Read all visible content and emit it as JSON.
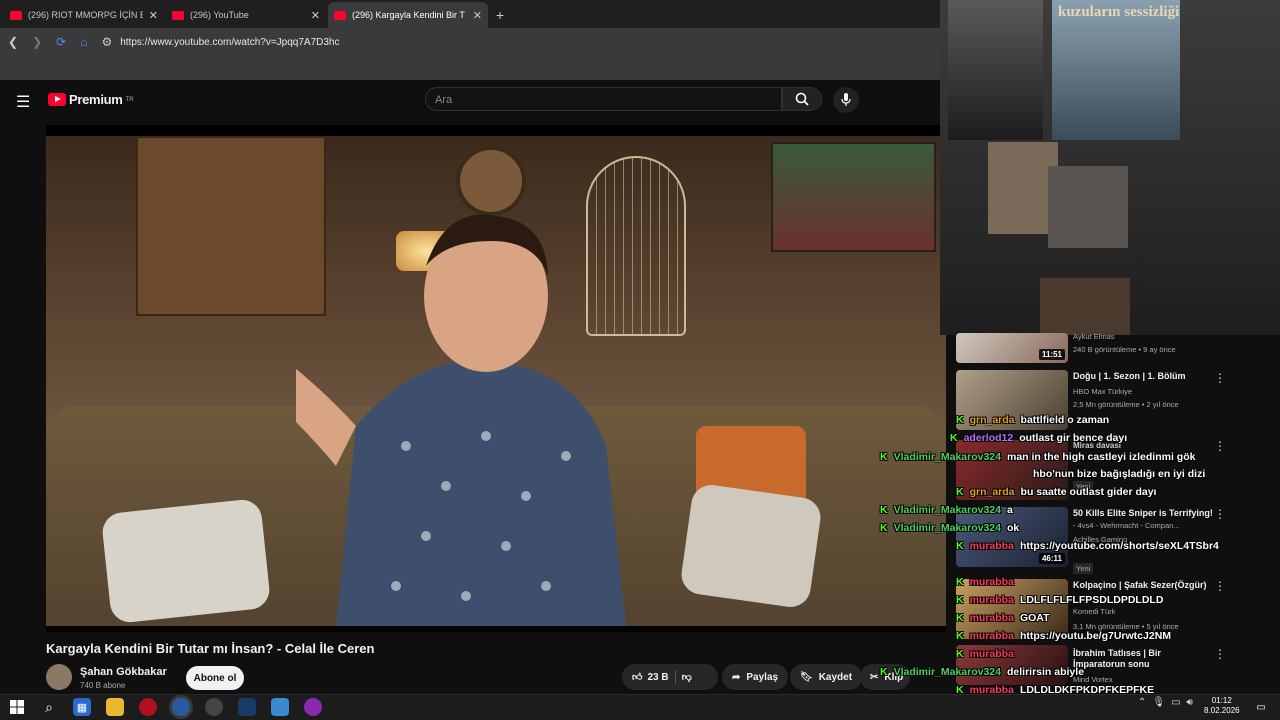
{
  "browser": {
    "tabs": [
      {
        "label": "(296) RIOT MMORPG İÇİN BİR A"
      },
      {
        "label": "(296) YouTube"
      },
      {
        "label": "(296) Kargayla Kendini Bir T"
      }
    ],
    "new_tab": "+",
    "url": "https://www.youtube.com/watch?v=Jpqq7A7D3hc"
  },
  "youtube": {
    "logo_text": "Premium",
    "logo_sup": "TR",
    "search_placeholder": "Ara",
    "video_title": "Kargayla Kendini Bir Tutar mı İnsan? - Celal İle Ceren",
    "channel_name": "Şahan Gökbakar",
    "subscribers": "740 B abone",
    "subscribe_label": "Abone ol",
    "likes": "23 B",
    "share_label": "Paylaş",
    "save_label": "Kaydet",
    "clip_label": "Klip"
  },
  "recommended": [
    {
      "title": "",
      "channel": "Aykut Elmas",
      "meta": "240 B görüntüleme • 9 ay önce",
      "duration": "11:51"
    },
    {
      "title": "Doğu | 1. Sezon | 1. Bölüm",
      "channel": "HBO Max Türkiye",
      "meta": "2,5 Mn görüntüleme • 2 yıl önce",
      "duration": ""
    },
    {
      "title": "Miras davası",
      "channel": "",
      "meta": "Yeni",
      "duration": ""
    },
    {
      "title": "50 Kills Elite Sniper is Terrifying!",
      "channel": "Achilles Gaming",
      "meta": "- 4vs4 - Wehrmacht - Compan...",
      "duration": "46:11",
      "badge": "Yeni"
    },
    {
      "title": "Kolpaçino | Şafak Sezer(Özgür)",
      "channel": "Komedi Türk",
      "meta": "3,1 Mn görüntüleme • 5 yıl önce",
      "duration": ""
    },
    {
      "title": "İbrahim Tatlıses | Bir İmparatorun sonu",
      "channel": "Mind Vortex",
      "meta": "",
      "duration": ""
    }
  ],
  "chat": [
    {
      "user": "grn_arda",
      "color": "#e4a020",
      "msg": "battlfield o zaman"
    },
    {
      "user": "aderlod12",
      "color": "#b86cff",
      "msg": "outlast gir bence dayı"
    },
    {
      "user": "Vladimir_Makarov324",
      "color": "#4cd060",
      "msg": "man in the high castleyi izledinmi gök"
    },
    {
      "user": "",
      "color": "#ffffff",
      "msg": "hbo'nun bize bağışladığı en iyi dizi"
    },
    {
      "user": "grn_arda",
      "color": "#e4a020",
      "msg": "bu saatte outlast gider dayı"
    },
    {
      "user": "Vladimir_Makarov324",
      "color": "#4cd060",
      "msg": "a"
    },
    {
      "user": "Vladimir_Makarov324",
      "color": "#4cd060",
      "msg": "ok"
    },
    {
      "user": "murabba",
      "color": "#ff3a5a",
      "msg": "https://youtube.com/shorts/seXL4TSbr4"
    },
    {
      "user": "murabba",
      "color": "#ff3a5a",
      "msg": ""
    },
    {
      "user": "murabba",
      "color": "#ff3a5a",
      "msg": "LDLFLFLFLFPSDLDPDLDLD"
    },
    {
      "user": "murabba",
      "color": "#ff3a5a",
      "msg": "GOAT"
    },
    {
      "user": "murabba",
      "color": "#ff3a5a",
      "msg": "https://youtu.be/g7UrwtcJ2NM"
    },
    {
      "user": "murabba",
      "color": "#ff3a5a",
      "msg": ""
    },
    {
      "user": "Vladimir_Makarov324",
      "color": "#4cd060",
      "msg": "delirirsin abiyle"
    },
    {
      "user": "murabba",
      "color": "#ff3a5a",
      "msg": "LDLDLDKFPKDPFKEPFKE"
    },
    {
      "user": "murabba",
      "color": "#ff3a5a",
      "msg": ""
    }
  ],
  "webcam": {
    "poster_text": "kuzuların sessizliği"
  },
  "taskbar": {
    "time": "01:12",
    "date": "8.02.2026"
  },
  "colors": {
    "yt_red": "#ff0033",
    "kick_green": "#53fc18",
    "bg": "#0f0f0f"
  }
}
